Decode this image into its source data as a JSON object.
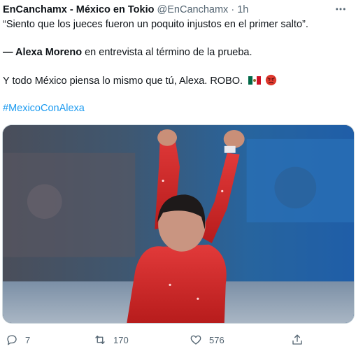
{
  "tweet": {
    "author_name": "EnCanchamx - México en Tokio",
    "handle": "@EnCanchamx",
    "separator": "·",
    "time": "1h",
    "line1": "“Siento que los jueces fueron un poquito injustos en el primer salto”.",
    "line2_bold": "— Alexa Moreno",
    "line2_rest": " en entrevista al término de la prueba.",
    "line3": "Y todo México piensa lo mismo que tú, Alexa. ROBO.",
    "hashtag": "#MexicoConAlexa"
  },
  "actions": {
    "replies": "7",
    "retweets": "170",
    "likes": "576"
  },
  "icons": {
    "more": "more-icon",
    "reply": "reply-icon",
    "retweet": "retweet-icon",
    "like": "heart-icon",
    "share": "share-icon",
    "flag": "mexico-flag-emoji",
    "angry": "angry-face-emoji"
  },
  "colors": {
    "text": "#0f1419",
    "muted": "#536471",
    "link": "#1d9bf0",
    "leotard": "#d62828"
  }
}
